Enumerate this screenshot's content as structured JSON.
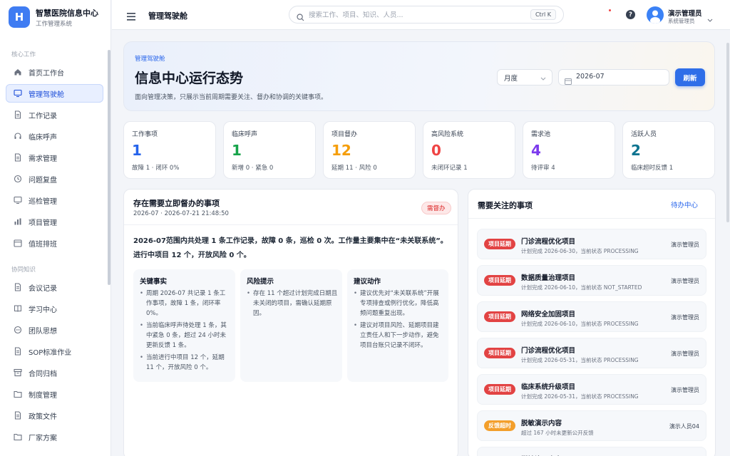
{
  "brand": {
    "logo_letter": "H",
    "name": "智慧医院信息中心",
    "subtitle": "工作管理系统"
  },
  "sidebar": {
    "groups": [
      {
        "label": "核心工作",
        "items": [
          {
            "label": "首页工作台",
            "icon": "home-icon"
          },
          {
            "label": "管理驾驶舱",
            "icon": "monitor-icon",
            "active": true
          },
          {
            "label": "工作记录",
            "icon": "document-icon"
          },
          {
            "label": "临床呼声",
            "icon": "headset-icon"
          },
          {
            "label": "需求管理",
            "icon": "document-icon"
          },
          {
            "label": "问题复盘",
            "icon": "clock-icon"
          },
          {
            "label": "巡检管理",
            "icon": "monitor-icon"
          },
          {
            "label": "项目管理",
            "icon": "bar-chart-icon"
          },
          {
            "label": "值班排班",
            "icon": "calendar-icon"
          }
        ]
      },
      {
        "label": "协同知识",
        "items": [
          {
            "label": "会议记录",
            "icon": "document-icon"
          },
          {
            "label": "学习中心",
            "icon": "book-icon"
          },
          {
            "label": "团队思想",
            "icon": "chat-icon"
          },
          {
            "label": "SOP标准作业",
            "icon": "document-icon"
          },
          {
            "label": "合同归档",
            "icon": "archive-icon"
          },
          {
            "label": "制度管理",
            "icon": "folder-icon"
          },
          {
            "label": "政策文件",
            "icon": "document-icon"
          },
          {
            "label": "厂家方案",
            "icon": "folder-icon"
          }
        ]
      }
    ]
  },
  "topbar": {
    "page_title": "管理驾驶舱",
    "search_placeholder": "搜索工作、项目、知识、人员...",
    "shortcut": "Ctrl K",
    "help_label": "?",
    "user_name": "演示管理员",
    "user_role": "系统管理员"
  },
  "hero": {
    "tag": "管理驾驶舱",
    "title": "信息中心运行态势",
    "description": "面向管理决策，只展示当前周期需要关注、督办和协调的关键事项。",
    "period_value": "月度",
    "date_value": "2026-07",
    "refresh_label": "刷新"
  },
  "stats": [
    {
      "label": "工作事项",
      "value": "1",
      "note": "故障 1 · 闭环 0%",
      "color": "#2563eb"
    },
    {
      "label": "临床呼声",
      "value": "1",
      "note": "新增 0 · 紧急 0",
      "color": "#16a34a"
    },
    {
      "label": "项目督办",
      "value": "12",
      "note": "延期 11 · 风险 0",
      "color": "#f59e0b"
    },
    {
      "label": "高风险系统",
      "value": "0",
      "note": "未闭环记录 1",
      "color": "#ef4444"
    },
    {
      "label": "需求池",
      "value": "4",
      "note": "待评审 4",
      "color": "#7c3aed"
    },
    {
      "label": "活跃人员",
      "value": "2",
      "note": "临床超时反馈 1",
      "color": "#0e7490"
    }
  ],
  "supervise": {
    "title": "存在需要立即督办的事项",
    "time_range": "2026-07 · 2026-07-21 21:48:50",
    "badge": "需督办",
    "summary": "2026-07范围内共处理 1 条工作记录，故障 0 条，巡检 0 次。工作量主要集中在“未关联系统”。进行中项目 12 个，开放风险 0 个。",
    "columns": [
      {
        "title": "关键事实",
        "points": [
          "周期 2026-07 共记录 1 条工作事项，故障 1 条，闭环率 0%。",
          "当前临床呼声待处理 1 条，其中紧急 0 条，超过 24 小时未更新反馈 1 条。",
          "当前进行中项目 12 个，延期 11 个，开放风险 0 个。"
        ]
      },
      {
        "title": "风险提示",
        "points": [
          "存在 11 个超过计划完成日期且未关闭的项目，需确认延期原因。"
        ]
      },
      {
        "title": "建议动作",
        "points": [
          "建议优先对“未关联系统”开展专项排查或例行优化，降低高频问题重复出现。",
          "建议对项目风险、延期项目建立责任人和下一步动作，避免项目台账只记录不闭环。"
        ]
      }
    ]
  },
  "attention": {
    "title": "需要关注的事项",
    "link": "待办中心",
    "items": [
      {
        "tag": "项目延期",
        "tag_type": "red",
        "title": "门诊流程优化项目",
        "subtitle": "计划完成 2026-06-30，当前状态 PROCESSING",
        "owner": "演示管理员"
      },
      {
        "tag": "项目延期",
        "tag_type": "red",
        "title": "数据质量治理项目",
        "subtitle": "计划完成 2026-06-10，当前状态 NOT_STARTED",
        "owner": "演示管理员"
      },
      {
        "tag": "项目延期",
        "tag_type": "red",
        "title": "网络安全加固项目",
        "subtitle": "计划完成 2026-06-10，当前状态 PROCESSING",
        "owner": "演示管理员"
      },
      {
        "tag": "项目延期",
        "tag_type": "red",
        "title": "门诊流程优化项目",
        "subtitle": "计划完成 2026-05-31，当前状态 PROCESSING",
        "owner": "演示管理员"
      },
      {
        "tag": "项目延期",
        "tag_type": "red",
        "title": "临床系统升级项目",
        "subtitle": "计划完成 2026-05-31，当前状态 PROCESSING",
        "owner": "演示管理员"
      },
      {
        "tag": "反馈超时",
        "tag_type": "orange",
        "title": "脱敏演示内容",
        "subtitle": "超过 167 小时未更新公开反馈",
        "owner": "演示人员04"
      },
      {
        "tag": "",
        "tag_type": "gray",
        "title": "脱敏演示内容",
        "subtitle": "",
        "owner": ""
      }
    ]
  }
}
